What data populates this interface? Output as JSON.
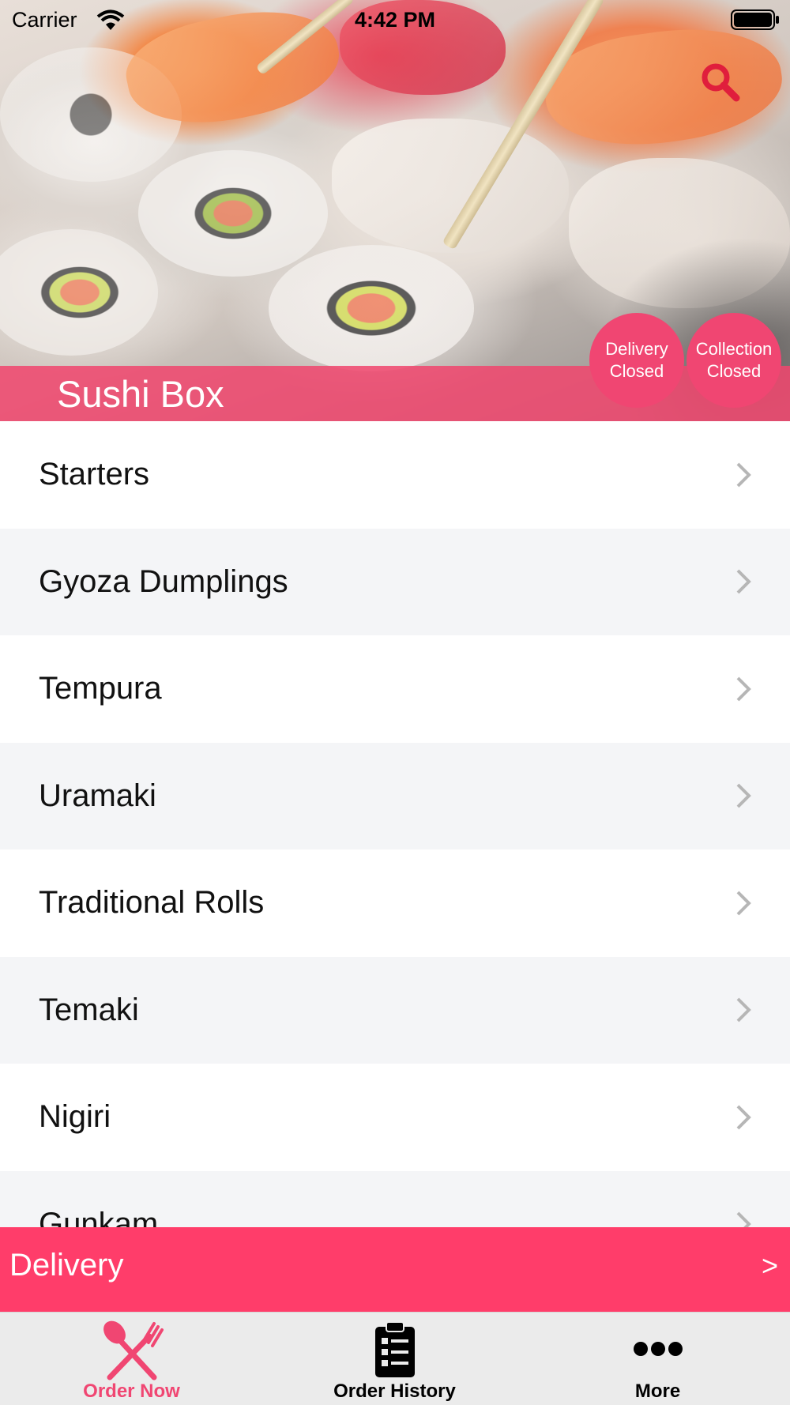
{
  "status_bar": {
    "carrier": "Carrier",
    "time": "4:42 PM"
  },
  "header": {
    "restaurant_name": "Sushi Box",
    "search_icon": "search-icon",
    "delivery_status": [
      "Delivery",
      "Closed"
    ],
    "collection_status": [
      "Collection",
      "Closed"
    ]
  },
  "menu": {
    "categories": [
      {
        "label": "Starters"
      },
      {
        "label": "Gyoza Dumplings"
      },
      {
        "label": "Tempura"
      },
      {
        "label": "Uramaki"
      },
      {
        "label": "Traditional Rolls"
      },
      {
        "label": "Temaki"
      },
      {
        "label": "Nigiri"
      },
      {
        "label": "Gunkam"
      }
    ]
  },
  "order_mode": {
    "label": "Delivery",
    "arrow": ">"
  },
  "tab_bar": {
    "tabs": [
      {
        "label": "Order Now",
        "icon": "fork-knife-icon",
        "active": true
      },
      {
        "label": "Order History",
        "icon": "clipboard-list-icon",
        "active": false
      },
      {
        "label": "More",
        "icon": "more-dots-icon",
        "active": false
      }
    ]
  },
  "colors": {
    "accent": "#ff3d6a",
    "tab_active": "#f04672",
    "search_icon": "#e01e3c"
  }
}
